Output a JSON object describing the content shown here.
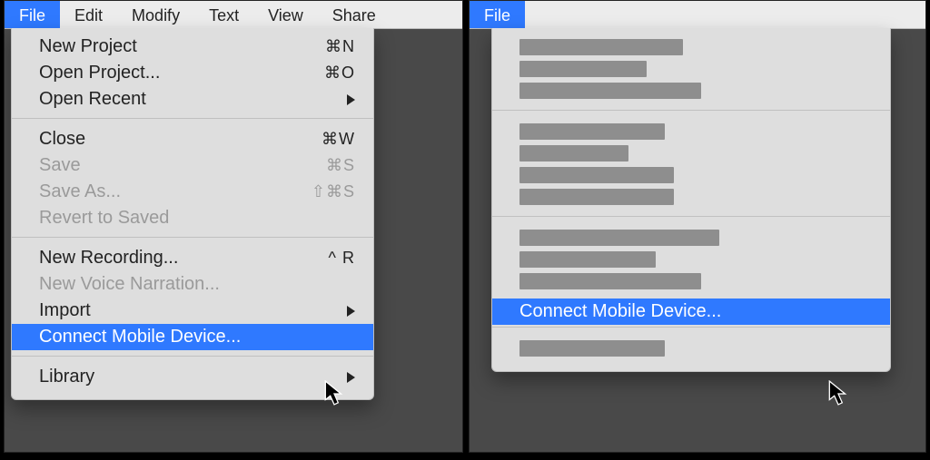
{
  "menubar": {
    "file": "File",
    "edit": "Edit",
    "modify": "Modify",
    "text": "Text",
    "view": "View",
    "share": "Share"
  },
  "menu_left": {
    "new_project": {
      "label": "New Project",
      "shortcut": "⌘N"
    },
    "open_project": {
      "label": "Open Project...",
      "shortcut": "⌘O"
    },
    "open_recent": {
      "label": "Open Recent"
    },
    "close": {
      "label": "Close",
      "shortcut": "⌘W"
    },
    "save": {
      "label": "Save",
      "shortcut": "⌘S"
    },
    "save_as": {
      "label": "Save As...",
      "shortcut": "⇧⌘S"
    },
    "revert": {
      "label": "Revert to Saved"
    },
    "new_recording": {
      "label": "New Recording...",
      "shortcut": "^ R"
    },
    "new_voice": {
      "label": "New Voice Narration..."
    },
    "import": {
      "label": "Import"
    },
    "connect_mobile": {
      "label": "Connect Mobile Device..."
    },
    "library": {
      "label": "Library"
    }
  },
  "menu_right": {
    "connect_mobile": {
      "label": "Connect Mobile Device..."
    }
  }
}
